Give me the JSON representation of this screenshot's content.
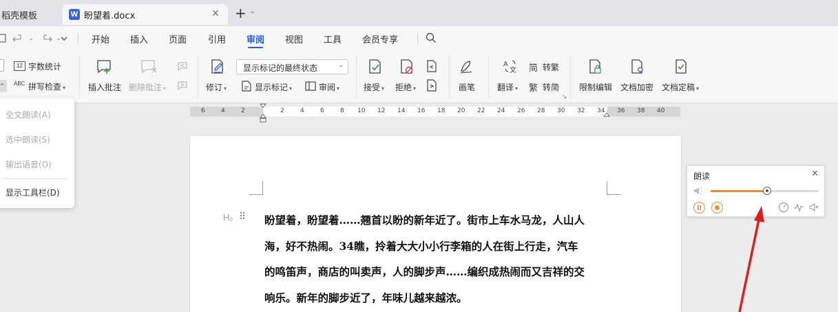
{
  "titlebar": {
    "tab_inactive_label": "稻壳模板",
    "tab_active_label": "盼望着.docx",
    "tab_active_icon": "W",
    "close_symbol": "✕",
    "new_tab_symbol": "+",
    "new_tab_caret": "⌄"
  },
  "menubar": {
    "items": [
      "开始",
      "插入",
      "页面",
      "引用",
      "审阅",
      "视图",
      "工具",
      "会员专享"
    ],
    "active": "审阅"
  },
  "ribbon": {
    "word_count": "字数统计",
    "spell_check": "拼写检查",
    "insert_comment": "插入批注",
    "delete_comment": "删除批注",
    "revise": "修订",
    "markup_select": "显示标记的最终状态",
    "show_markup": "显示标记",
    "review": "审阅",
    "accept": "接受",
    "reject": "拒绝",
    "pen": "画笔",
    "translate": "翻译",
    "to_traditional": "转繁",
    "to_simplified": "转简",
    "restrict_edit": "限制编辑",
    "encrypt": "文档加密",
    "finalize": "文档定稿",
    "word_count_icon_text": "12",
    "spell_icon_text": "ABC",
    "trad_icon_text": "简",
    "simp_icon_text": "繁",
    "translate_icon_text": "文"
  },
  "ruler": {
    "labels": [
      "6",
      "4",
      "2",
      "2",
      "4",
      "6",
      "8",
      "10",
      "12",
      "14",
      "16",
      "18",
      "20",
      "22",
      "24",
      "26",
      "28",
      "30",
      "32",
      "34",
      "36",
      "38",
      "40"
    ]
  },
  "dropdown": {
    "items": [
      "全文朗读(A)",
      "选中朗读(S)",
      "输出语音(O)",
      "显示工具栏(D)"
    ]
  },
  "document": {
    "heading_marker": "H₂",
    "drag_handle": "⠿",
    "lines": [
      "盼望着，盼望着……翘首以盼的新年近了。街市上车水马龙，人山人",
      "海，好不热闹。34瞧，拎着大大小小行李箱的人在街上行走，汽车",
      "的鸣笛声，商店的叫卖声，人的脚步声……编织成热闹而又吉祥的交",
      "响乐。新年的脚步近了，年味儿越来越浓。"
    ]
  },
  "readpanel": {
    "title": "朗读",
    "close_symbol": "✕",
    "progress": 0.52
  },
  "colors": {
    "accent_blue": "#2b5fd9",
    "accent_orange": "#e68a2e",
    "arrow_red": "#d92020"
  }
}
